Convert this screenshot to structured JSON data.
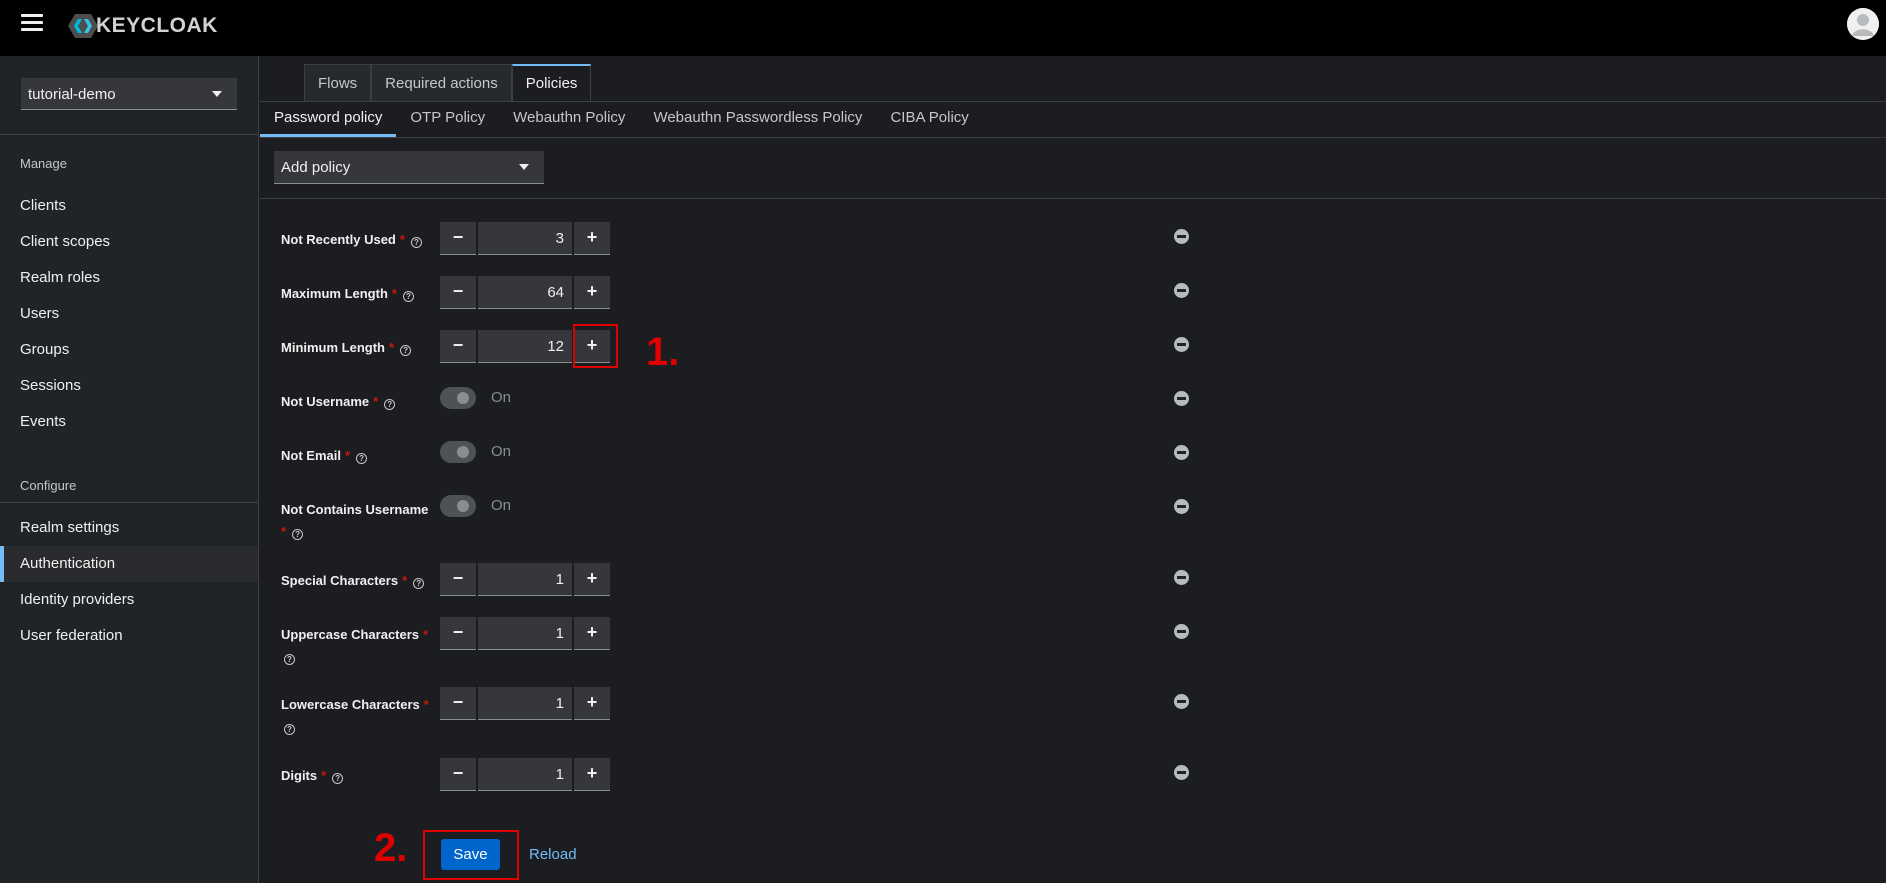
{
  "brand": {
    "name": "KEYCLOAK"
  },
  "sidebar": {
    "realm": "tutorial-demo",
    "manage_heading": "Manage",
    "manage_items": [
      {
        "label": "Clients"
      },
      {
        "label": "Client scopes"
      },
      {
        "label": "Realm roles"
      },
      {
        "label": "Users"
      },
      {
        "label": "Groups"
      },
      {
        "label": "Sessions"
      },
      {
        "label": "Events"
      }
    ],
    "configure_heading": "Configure",
    "configure_items": [
      {
        "label": "Realm settings"
      },
      {
        "label": "Authentication",
        "active": true
      },
      {
        "label": "Identity providers"
      },
      {
        "label": "User federation"
      }
    ]
  },
  "tabs": [
    {
      "label": "Flows"
    },
    {
      "label": "Required actions"
    },
    {
      "label": "Policies",
      "active": true
    }
  ],
  "subtabs": [
    {
      "label": "Password policy",
      "active": true
    },
    {
      "label": "OTP Policy"
    },
    {
      "label": "Webauthn Policy"
    },
    {
      "label": "Webauthn Passwordless Policy"
    },
    {
      "label": "CIBA Policy"
    }
  ],
  "add_policy": {
    "label": "Add policy"
  },
  "policies": [
    {
      "label": "Not Recently Used",
      "type": "number",
      "value": "3"
    },
    {
      "label": "Maximum Length",
      "type": "number",
      "value": "64"
    },
    {
      "label": "Minimum Length",
      "type": "number",
      "value": "12"
    },
    {
      "label": "Not Username",
      "type": "switch",
      "value": "On"
    },
    {
      "label": "Not Email",
      "type": "switch",
      "value": "On"
    },
    {
      "label": "Not Contains Username",
      "type": "switch",
      "value": "On"
    },
    {
      "label": "Special Characters",
      "type": "number",
      "value": "1"
    },
    {
      "label": "Uppercase Characters",
      "type": "number",
      "value": "1"
    },
    {
      "label": "Lowercase Characters",
      "type": "number",
      "value": "1"
    },
    {
      "label": "Digits",
      "type": "number",
      "value": "1"
    }
  ],
  "required_mark": "*",
  "help_glyph": "?",
  "minus_glyph": "−",
  "plus_glyph": "+",
  "actions": {
    "save": "Save",
    "reload": "Reload"
  },
  "annotations": {
    "step1": "1.",
    "step2": "2.",
    "color": "#e00000"
  },
  "colors": {
    "accent": "#73bcf7",
    "primary_button": "#0066cc",
    "required": "#c9190b"
  }
}
